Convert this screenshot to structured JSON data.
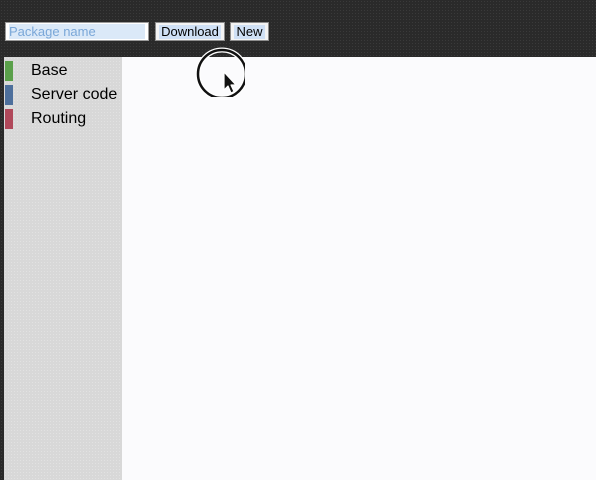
{
  "toolbar": {
    "package_input": {
      "value": "",
      "placeholder": "Package name"
    },
    "download_label": "Download",
    "new_label": "New"
  },
  "sidebar": {
    "items": [
      {
        "label": "Base",
        "color": "#5aa04a"
      },
      {
        "label": "Server code",
        "color": "#4d6f9c"
      },
      {
        "label": "Routing",
        "color": "#b0485a"
      }
    ]
  },
  "colors": {
    "topbar_bg": "#2a2a2a",
    "sidebar_bg": "#d8d8d8",
    "main_bg": "#fbfbfd",
    "selection_highlight": "#cfe0f5"
  },
  "cursor": {
    "icon": "pointer-arrow-icon",
    "indicator": "click-ring"
  }
}
